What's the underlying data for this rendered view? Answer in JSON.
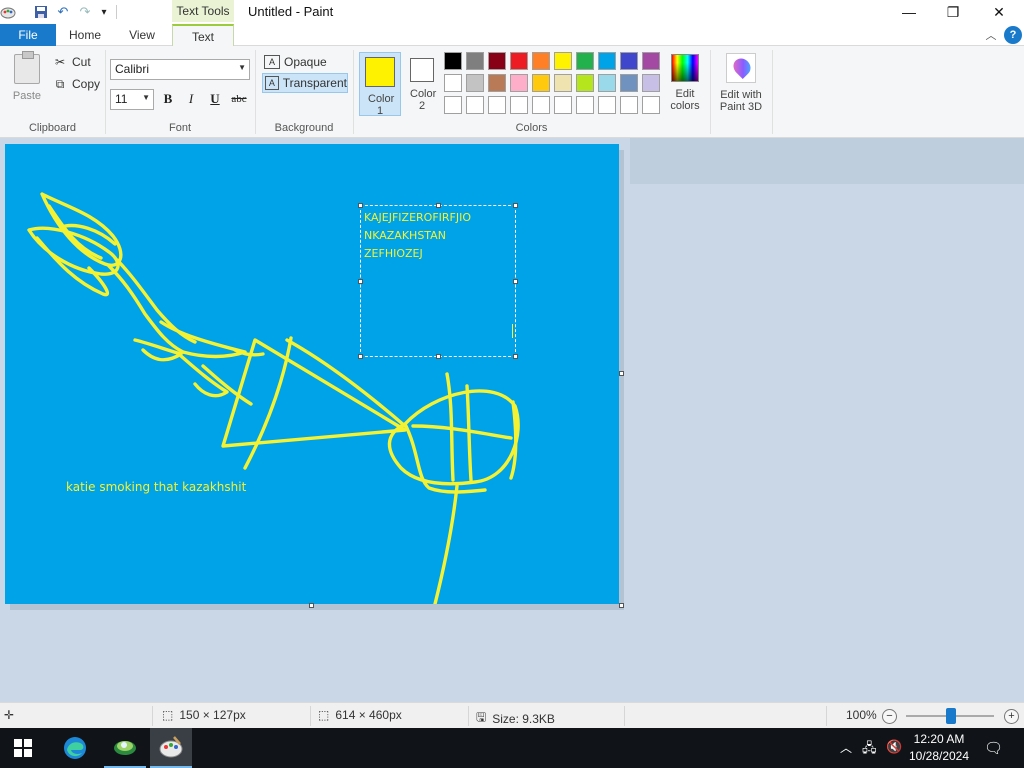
{
  "titlebar": {
    "window_title": "Untitled - Paint",
    "context_tab_label": "Text Tools",
    "minimize": "—",
    "maximize": "❐",
    "close": "✕"
  },
  "tabs": [
    {
      "label": "File",
      "selected": false
    },
    {
      "label": "Home",
      "selected": false
    },
    {
      "label": "View",
      "selected": false
    },
    {
      "label": "Text",
      "selected": true
    }
  ],
  "ribbon": {
    "clipboard": {
      "group_label": "Clipboard",
      "paste_label": "Paste",
      "cut_label": "Cut",
      "copy_label": "Copy"
    },
    "font": {
      "group_label": "Font",
      "family": "Calibri",
      "size": "11",
      "bold": "B",
      "italic": "I",
      "underline": "U",
      "strike": "abc"
    },
    "background": {
      "group_label": "Background",
      "opaque_label": "Opaque",
      "transparent_label": "Transparent",
      "selected": "Transparent"
    },
    "colors": {
      "group_label": "Colors",
      "color1_label": "Color 1",
      "color2_label": "Color 2",
      "color1_value": "#fff200",
      "color2_value": "#ffffff",
      "palette_row1": [
        "#000000",
        "#7f7f7f",
        "#880015",
        "#ed1c24",
        "#ff7f27",
        "#fff200",
        "#22b14c",
        "#00a2e8",
        "#3f48cc",
        "#a349a4"
      ],
      "palette_row2": [
        "#ffffff",
        "#c3c3c3",
        "#b97a57",
        "#ffaec9",
        "#ffc90e",
        "#efe4b0",
        "#b5e61d",
        "#99d9ea",
        "#7092be",
        "#c8bfe7"
      ],
      "palette_row3": [
        "#ffffff",
        "#ffffff",
        "#ffffff",
        "#ffffff",
        "#ffffff",
        "#ffffff",
        "#ffffff",
        "#ffffff",
        "#ffffff",
        "#ffffff"
      ],
      "edit_colors_line1": "Edit",
      "edit_colors_line2": "colors",
      "paint3d_line1": "Edit with",
      "paint3d_line2": "Paint 3D"
    }
  },
  "canvas": {
    "background_color": "#00a2e8",
    "text_box_lines": "KAJEJFIZEROFIRFJIO\nNKAZAKHSTAN\nZEFHIOZEJ",
    "caption_text": "katie smoking that kazakhshit"
  },
  "statusbar": {
    "selection_size": "150 × 127px",
    "canvas_size": "614 × 460px",
    "file_size": "Size: 9.3KB",
    "zoom": "100%"
  },
  "taskbar": {
    "time": "12:20 AM",
    "date": "10/28/2024"
  }
}
